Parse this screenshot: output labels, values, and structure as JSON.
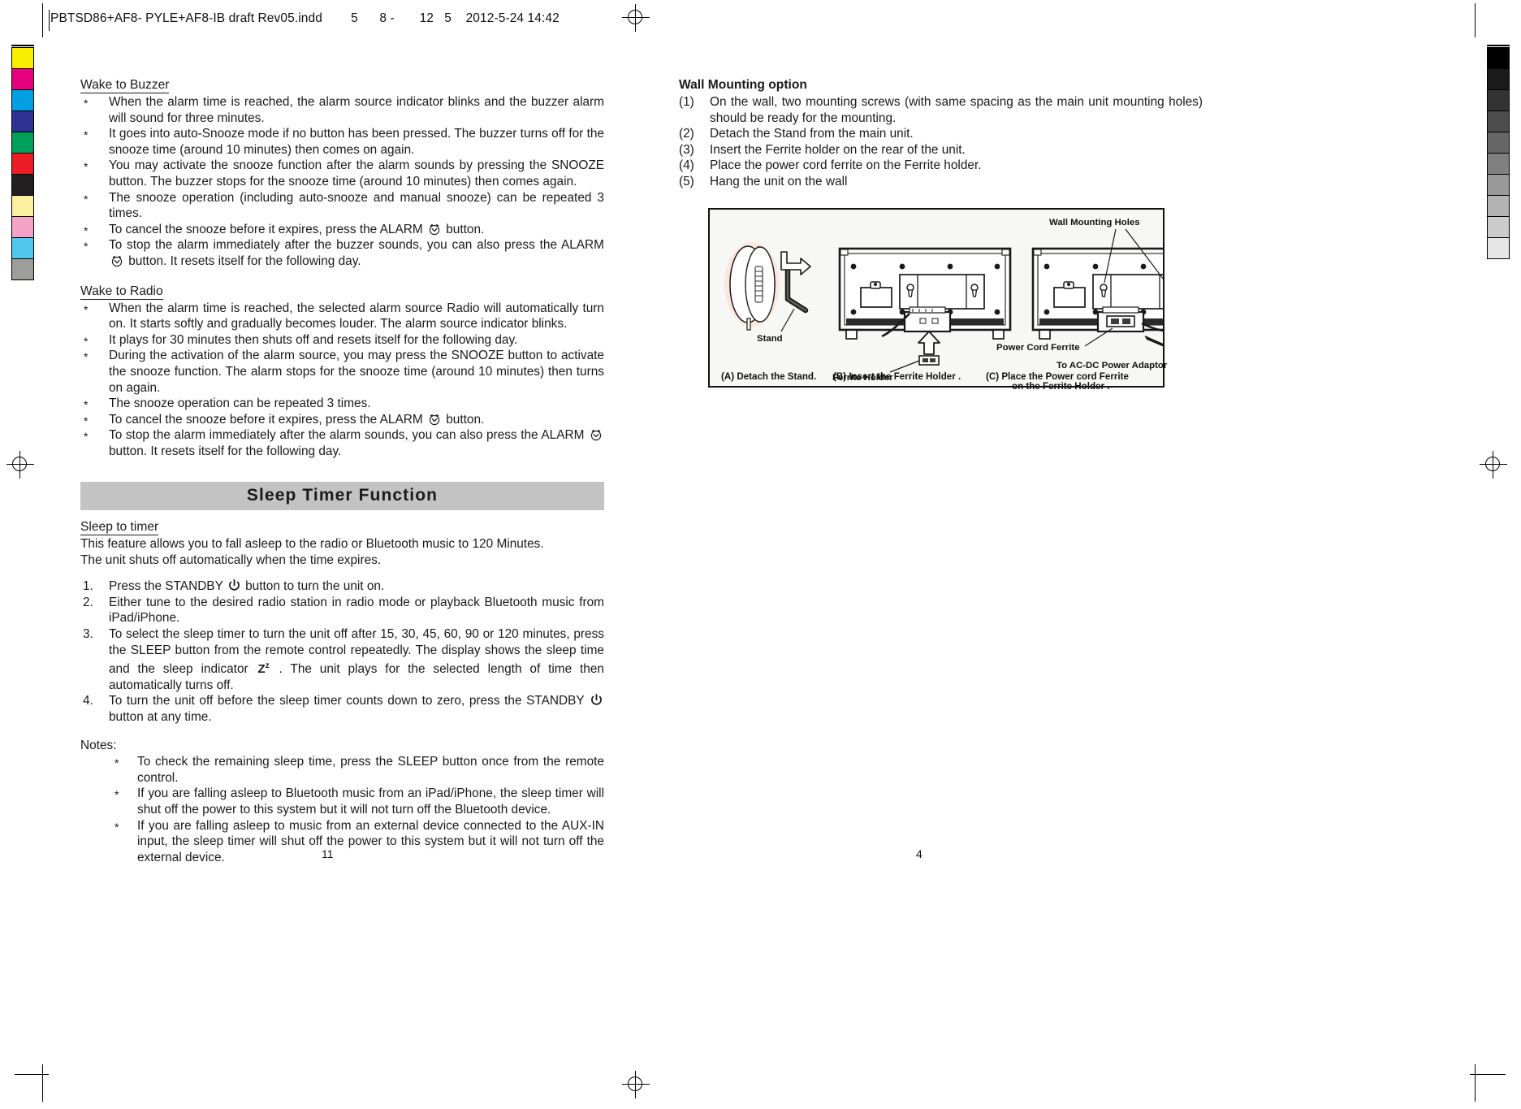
{
  "slug": {
    "text": "PBTSD86+AF8- PYLE+AF8-IB draft Rev05.indd        5      8 -       12   5    2012-5-24 14:42"
  },
  "colorbar": {
    "swatches": [
      "#faee00",
      "#e6007e",
      "#00a0e3",
      "#2e3192",
      "#00a05a",
      "#ed1c24",
      "#231f20",
      "#faf0a0",
      "#f2a3c7",
      "#50c8f0",
      "#9d9d9c"
    ]
  },
  "greybar": {
    "swatches": [
      "#000000",
      "#1a1a1a",
      "#333333",
      "#4d4d4d",
      "#666666",
      "#808080",
      "#999999",
      "#b3b3b3",
      "#cccccc",
      "#e6e6e6"
    ]
  },
  "left_column": {
    "section1": {
      "heading": "Wake to Buzzer",
      "bullets": [
        "When the alarm time is reached, the alarm source indicator blinks and the buzzer alarm will sound for three minutes.",
        "It goes into auto-Snooze mode if no button has been pressed. The buzzer turns off for the snooze time (around 10 minutes) then comes on again.",
        "You may activate the snooze function after the alarm sounds by pressing the SNOOZE button. The buzzer stops for the snooze time (around 10 minutes) then comes again.",
        "The snooze operation (including auto-snooze and manual snooze) can be repeated 3 times."
      ],
      "bullet_cancel_pre": "To cancel the snooze before it expires, press the ALARM ",
      "bullet_cancel_post": " button.",
      "bullet_stop_pre": "To stop the alarm immediately after the buzzer sounds, you can also press the ALARM ",
      "bullet_stop_post": " button. It resets itself for the following day."
    },
    "section2": {
      "heading": "Wake to Radio",
      "bullets": [
        "When the alarm time is reached, the selected alarm source Radio will automatically turn on. It starts softly and gradually becomes louder. The alarm source indicator blinks.",
        "It plays for 30 minutes then shuts off and resets itself for the following day.",
        "During the activation of the alarm source, you may press the SNOOZE button to activate the snooze function. The alarm stops for the snooze time (around 10 minutes) then turns on again.",
        "The snooze operation can be repeated 3 times."
      ],
      "bullet_cancel_pre": "To cancel the snooze before it expires, press the ALARM ",
      "bullet_cancel_post": " button.",
      "bullet_stop_pre": "To stop the alarm immediately after the alarm sounds, you can also press the ALARM ",
      "bullet_stop_post": " button. It resets itself for the following day."
    },
    "band_title": "Sleep Timer Function",
    "section3": {
      "heading": "Sleep to timer",
      "intro_line1": "This feature allows you to fall asleep to the radio or Bluetooth music to 120 Minutes.",
      "intro_line2": "The unit shuts off automatically when the time expires.",
      "step1_pre": "Press the STANDBY ",
      "step1_post": " button to turn the unit on.",
      "step2": "Either tune to the desired radio station in radio mode or playback Bluetooth music from iPad/iPhone.",
      "step3_pre": "To select the sleep timer to turn the unit off after 15, 30, 45, 60, 90 or 120 minutes, press the SLEEP button from the remote control repeatedly. The display shows the sleep time and the sleep indicator ",
      "step3_post": " . The unit plays for the selected length of time then automatically turns off.",
      "step4_pre": "To turn the unit off before the sleep timer counts down to zero, press the STANDBY ",
      "step4_post": " button at any time.",
      "markers": [
        "1.",
        "2.",
        "3.",
        "4."
      ],
      "notes_label": "Notes:",
      "notes": [
        "To check the remaining sleep time, press the SLEEP button once from the remote control.",
        "If you are falling asleep to Bluetooth music from an iPad/iPhone, the sleep timer will shut off the power to this system but it will not turn off the Bluetooth device.",
        "If you are falling asleep to music from an external device connected to the AUX-IN input, the sleep timer will shut off the power to this system but it will not turn off the external device."
      ]
    },
    "page_number": "11"
  },
  "right_column": {
    "heading": "Wall Mounting option",
    "steps": [
      {
        "marker": "(1)",
        "text": "On the wall, two mounting screws (with same spacing as the main unit mounting holes) should be ready for the mounting."
      },
      {
        "marker": "(2)",
        "text": "Detach the Stand from the main unit."
      },
      {
        "marker": "(3)",
        "text": "Insert the Ferrite holder on the rear of the unit."
      },
      {
        "marker": "(4)",
        "text": "Place the power cord ferrite on the Ferrite holder."
      },
      {
        "marker": "(5)",
        "text": "Hang the unit on the wall"
      }
    ],
    "figure": {
      "labels": {
        "wall_mounting_holes": "Wall Mounting Holes",
        "stand": "Stand",
        "ferrite_holder": "Ferrite Holder",
        "power_cord_ferrite": "Power Cord Ferrite",
        "to_ac_dc": "To AC-DC Power Adaptor"
      },
      "captions": {
        "a": "(A) Detach the Stand.",
        "b": "(B) Insert the Ferrite Holder .",
        "c1": "(C) Place the Power cord Ferrite",
        "c2": "on the Ferrite Holder ."
      }
    },
    "page_number": "4"
  },
  "colors": {
    "band_bg": "#c3c3c3",
    "text": "#1a1a1a",
    "figure_bg": "#f7f7f5"
  },
  "star": "*"
}
